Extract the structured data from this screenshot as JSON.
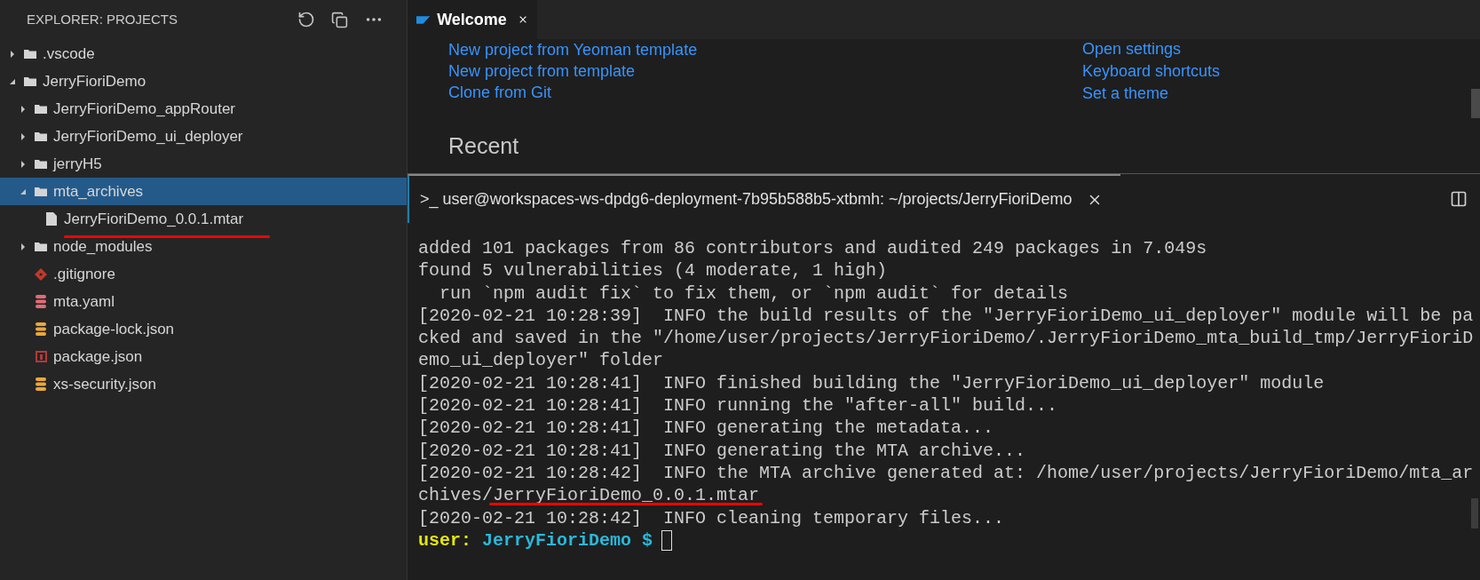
{
  "sidebar": {
    "title": "EXPLORER: PROJECTS",
    "tree": [
      {
        "label": ".vscode",
        "kind": "folder",
        "expanded": false,
        "selected": false
      },
      {
        "label": "JerryFioriDemo",
        "kind": "folder",
        "expanded": true,
        "selected": false,
        "children": [
          {
            "label": "JerryFioriDemo_appRouter",
            "kind": "folder",
            "expanded": false,
            "selected": false
          },
          {
            "label": "JerryFioriDemo_ui_deployer",
            "kind": "folder",
            "expanded": false,
            "selected": false
          },
          {
            "label": "jerryH5",
            "kind": "folder",
            "expanded": false,
            "selected": false
          },
          {
            "label": "mta_archives",
            "kind": "folder",
            "expanded": true,
            "selected": true,
            "children": [
              {
                "label": "JerryFioriDemo_0.0.1.mtar",
                "kind": "file",
                "selected": false,
                "underlined": true
              }
            ]
          },
          {
            "label": "node_modules",
            "kind": "folder",
            "expanded": false,
            "selected": false
          },
          {
            "label": ".gitignore",
            "kind": "git",
            "selected": false
          },
          {
            "label": "mta.yaml",
            "kind": "yaml",
            "selected": false
          },
          {
            "label": "package-lock.json",
            "kind": "json",
            "selected": false
          },
          {
            "label": "package.json",
            "kind": "npm",
            "selected": false
          },
          {
            "label": "xs-security.json",
            "kind": "json",
            "selected": false
          }
        ]
      }
    ]
  },
  "editor": {
    "tabs": [
      {
        "label": "Welcome",
        "selected": true
      }
    ],
    "start_links": [
      "New project from Yeoman template",
      "New project from template",
      "Clone from Git"
    ],
    "help_links": [
      "Open settings",
      "Keyboard shortcuts",
      "Set a theme"
    ],
    "recent_heading": "Recent"
  },
  "terminal": {
    "tab": {
      "prompt_glyph": ">_",
      "label": "user@workspaces-ws-dpdg6-deployment-7b95b588b5-xtbmh: ~/projects/JerryFioriDemo",
      "selected": true
    },
    "lines": [
      {
        "text": "added 101 packages from 86 contributors and audited 249 packages in 7.049s"
      },
      {
        "text": "found 5 vulnerabilities (4 moderate, 1 high)"
      },
      {
        "text": "  run `npm audit fix` to fix them, or `npm audit` for details"
      },
      {
        "text": "[2020-02-21 10:28:39]  INFO the build results of the \"JerryFioriDemo_ui_deployer\" module will be pa"
      },
      {
        "text": "cked and saved in the \"/home/user/projects/JerryFioriDemo/.JerryFioriDemo_mta_build_tmp/JerryFioriD"
      },
      {
        "text": "emo_ui_deployer\" folder"
      },
      {
        "text": "[2020-02-21 10:28:41]  INFO finished building the \"JerryFioriDemo_ui_deployer\" module"
      },
      {
        "text": "[2020-02-21 10:28:41]  INFO running the \"after-all\" build..."
      },
      {
        "text": "[2020-02-21 10:28:41]  INFO generating the metadata..."
      },
      {
        "text": "[2020-02-21 10:28:41]  INFO generating the MTA archive..."
      },
      {
        "text": "[2020-02-21 10:28:42]  INFO the MTA archive generated at: /home/user/projects/JerryFioriDemo/mta_ar"
      },
      {
        "text": "chives/",
        "underlined_text": "JerryFioriDemo_0.0.1.mtar"
      },
      {
        "text": "[2020-02-21 10:28:42]  INFO cleaning temporary files..."
      }
    ],
    "prompt": {
      "user": "user:",
      "path": "JerryFioriDemo $"
    }
  }
}
